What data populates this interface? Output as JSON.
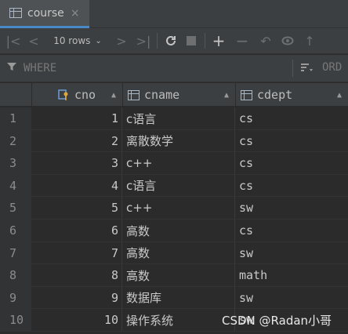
{
  "tab": {
    "title": "course",
    "close": "×"
  },
  "toolbar": {
    "rows_label": "10 rows",
    "icons": [
      "first-page-icon",
      "prev-page-icon",
      "rows-dropdown",
      "next-page-icon",
      "last-page-icon",
      "refresh-icon",
      "stop-icon",
      "add-row-icon",
      "delete-row-icon",
      "revert-icon",
      "preview-icon",
      "submit-icon"
    ]
  },
  "filter": {
    "where_label": "WHERE",
    "order_label": "ORD"
  },
  "columns": [
    {
      "name": "cno",
      "key": true
    },
    {
      "name": "cname",
      "key": false
    },
    {
      "name": "cdept",
      "key": false
    }
  ],
  "rows": [
    {
      "num": "1",
      "cno": "1",
      "cname": "c语言",
      "cdept": "cs"
    },
    {
      "num": "2",
      "cno": "2",
      "cname": "离散数学",
      "cdept": "cs"
    },
    {
      "num": "3",
      "cno": "3",
      "cname": "c++",
      "cdept": "cs"
    },
    {
      "num": "4",
      "cno": "4",
      "cname": "c语言",
      "cdept": "cs"
    },
    {
      "num": "5",
      "cno": "5",
      "cname": "c++",
      "cdept": "sw"
    },
    {
      "num": "6",
      "cno": "6",
      "cname": "高数",
      "cdept": "cs"
    },
    {
      "num": "7",
      "cno": "7",
      "cname": "高数",
      "cdept": "sw"
    },
    {
      "num": "8",
      "cno": "8",
      "cname": "高数",
      "cdept": "math"
    },
    {
      "num": "9",
      "cno": "9",
      "cname": "数据库",
      "cdept": "sw"
    },
    {
      "num": "10",
      "cno": "10",
      "cname": "操作系统",
      "cdept": "sw"
    }
  ],
  "watermark": "CSDN @Radan小哥",
  "colors": {
    "tab_accent": "#4a88c7",
    "key_icon": "#e0a83a",
    "background": "#2b2b2b"
  }
}
